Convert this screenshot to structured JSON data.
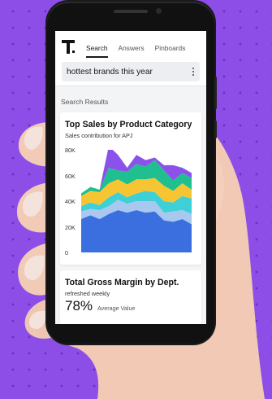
{
  "app": {
    "tabs": [
      {
        "label": "Search",
        "active": true
      },
      {
        "label": "Answers",
        "active": false
      },
      {
        "label": "Pinboards",
        "active": false
      }
    ],
    "search_query": "hottest brands this year",
    "results_label": "Search Results"
  },
  "cards": {
    "sales": {
      "title": "Top Sales by Product Category",
      "subtitle": "Sales contribution for APJ"
    },
    "margin": {
      "title": "Total Gross Margin by Dept.",
      "subtitle": "refreshed weekly",
      "value": "78%",
      "value_caption": "Average Value"
    }
  },
  "colors": {
    "background": "#8d4ee8",
    "series": [
      "#3b6fe0",
      "#a9c8f0",
      "#3fcfd6",
      "#f7c531",
      "#1fbf8f",
      "#8a52ea"
    ]
  },
  "icons": [
    "thoughtspot-logo-icon",
    "more-vertical-icon"
  ],
  "chart_data": {
    "type": "area",
    "title": "Top Sales by Product Category",
    "subtitle": "Sales contribution for APJ",
    "ylim": [
      0,
      80000
    ],
    "y_ticks": [
      "0",
      "20K",
      "40K",
      "60K",
      "80K"
    ],
    "x_count": 13,
    "series": [
      {
        "values": [
          26000,
          29000,
          26000,
          30000,
          33000,
          31000,
          33000,
          31000,
          32000,
          25000,
          24000,
          26000,
          22000
        ]
      },
      {
        "values": [
          6000,
          5000,
          7000,
          6000,
          8000,
          7000,
          7000,
          9000,
          8000,
          6000,
          8000,
          7000,
          8000
        ]
      },
      {
        "values": [
          4000,
          5000,
          4000,
          7000,
          6000,
          5000,
          6000,
          8000,
          7000,
          9000,
          7000,
          11000,
          12000
        ]
      },
      {
        "values": [
          8000,
          9000,
          10000,
          11000,
          10000,
          10000,
          11000,
          9000,
          11000,
          12000,
          9000,
          10000,
          7000
        ]
      },
      {
        "values": [
          2000,
          3000,
          2000,
          12000,
          7000,
          10000,
          12000,
          10000,
          14000,
          12000,
          8000,
          8000,
          9000
        ]
      },
      {
        "values": [
          0,
          0,
          0,
          17000,
          12000,
          3000,
          7000,
          5000,
          2000,
          4000,
          12000,
          4000,
          4000
        ]
      }
    ]
  }
}
